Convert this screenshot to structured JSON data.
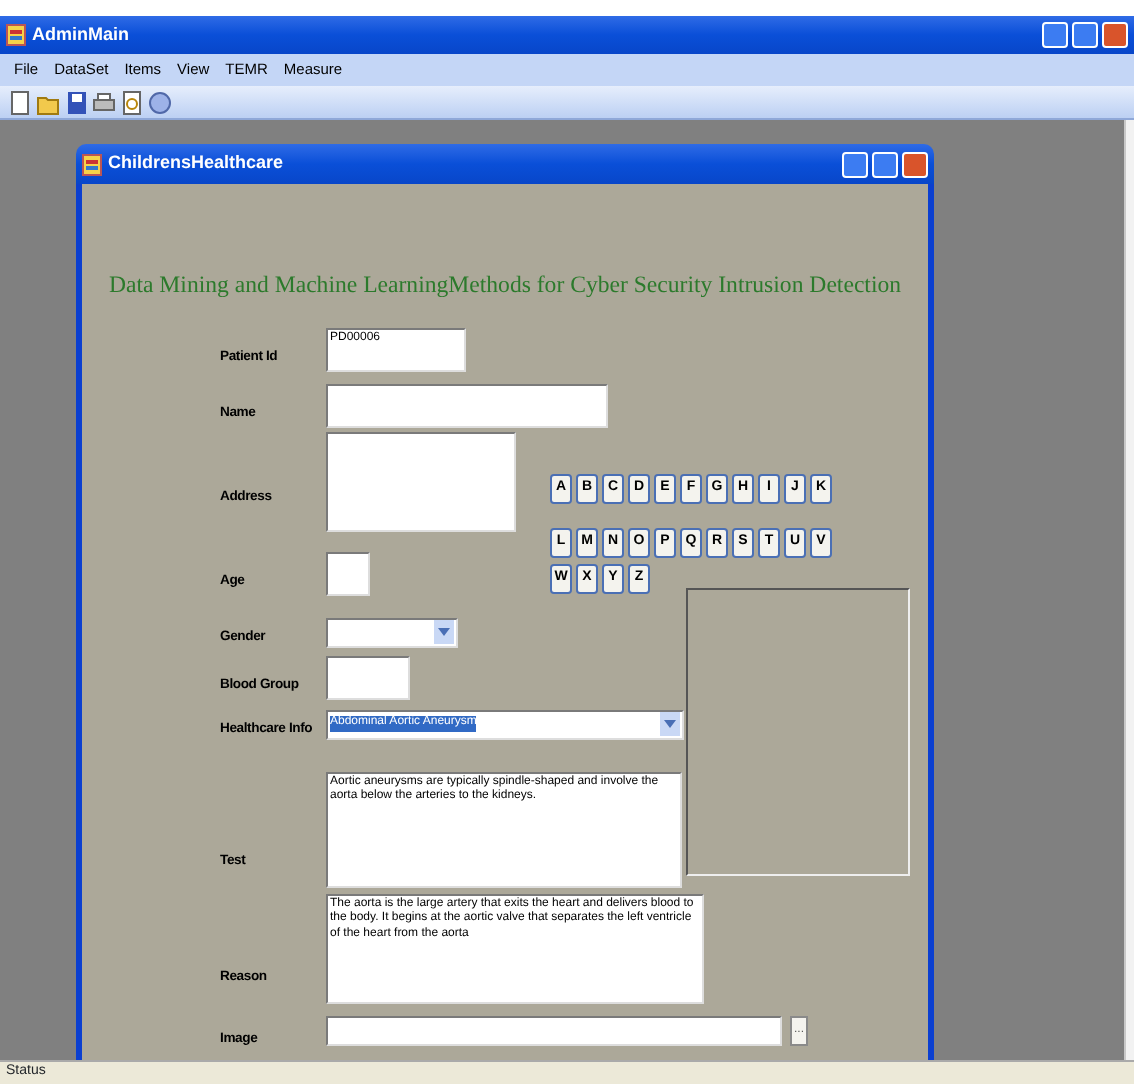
{
  "window": {
    "title": "AdminMain"
  },
  "menu": [
    "File",
    "DataSet",
    "Items",
    "View",
    "TEMR",
    "Measure"
  ],
  "child_window": {
    "title": "ChildrensHealthcare"
  },
  "heading": "Data Mining and Machine LearningMethods for Cyber Security Intrusion Detection",
  "fields": [
    {
      "label": "Patient Id",
      "kind": "text",
      "value": "PD00006"
    },
    {
      "label": "Name",
      "kind": "text"
    },
    {
      "label": "Address",
      "kind": "multiline"
    },
    {
      "label": "Age",
      "kind": "text"
    },
    {
      "label": "Gender",
      "kind": "combo"
    },
    {
      "label": "Blood Group",
      "kind": "text"
    },
    {
      "label": "Healthcare Info",
      "kind": "combo",
      "value": "Abdominal Aortic Aneurysm",
      "selected": true
    },
    {
      "label": "Test",
      "kind": "multiline",
      "value": "Aortic aneurysms are typically spindle-shaped and involve the aorta below the arteries to the kidneys."
    },
    {
      "label": "Reason",
      "kind": "multiline",
      "value": "The aorta is the large artery that exits the heart and delivers blood to the body. It begins at the aortic valve that separates the left ventricle of the heart from the aorta"
    },
    {
      "label": "Image",
      "kind": "file",
      "button": "..."
    }
  ],
  "letter_rows": [
    [
      "A",
      "B",
      "C",
      "D",
      "E",
      "F",
      "G",
      "H",
      "I",
      "J",
      "K"
    ],
    [
      "L",
      "M",
      "N",
      "O",
      "P",
      "Q",
      "R",
      "S",
      "T",
      "U",
      "V"
    ],
    [
      "W",
      "X",
      "Y",
      "Z"
    ]
  ],
  "status_bar": "Status"
}
